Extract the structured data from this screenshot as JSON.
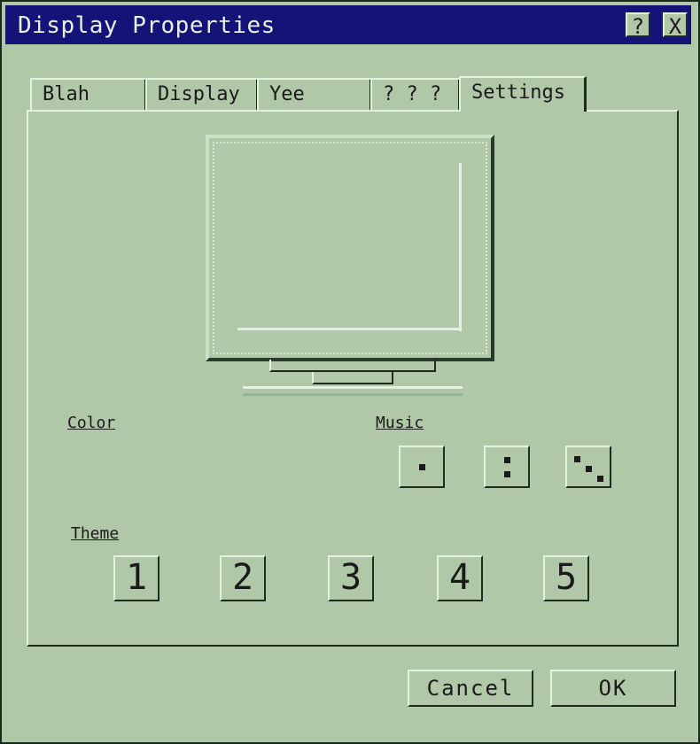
{
  "window": {
    "title": "Display Properties",
    "help_label": "?",
    "close_label": "X"
  },
  "tabs": [
    {
      "label": "Blah"
    },
    {
      "label": "Display"
    },
    {
      "label": "Yee"
    },
    {
      "label": "? ? ?"
    },
    {
      "label": "Settings",
      "active": true
    }
  ],
  "color_label": "Color",
  "music_label": "Music",
  "music_buttons": [
    "dice-one-icon",
    "dice-two-icon",
    "dice-three-icon"
  ],
  "theme_label": "Theme",
  "theme_buttons": [
    "1",
    "2",
    "3",
    "4",
    "5"
  ],
  "actions": {
    "cancel_label": "Cancel",
    "ok_label": "OK"
  },
  "colors": {
    "background": "#b0c8a8",
    "titlebar": "#141478",
    "highlight": "#e4f0e0",
    "shadow": "#1e2a1e"
  }
}
